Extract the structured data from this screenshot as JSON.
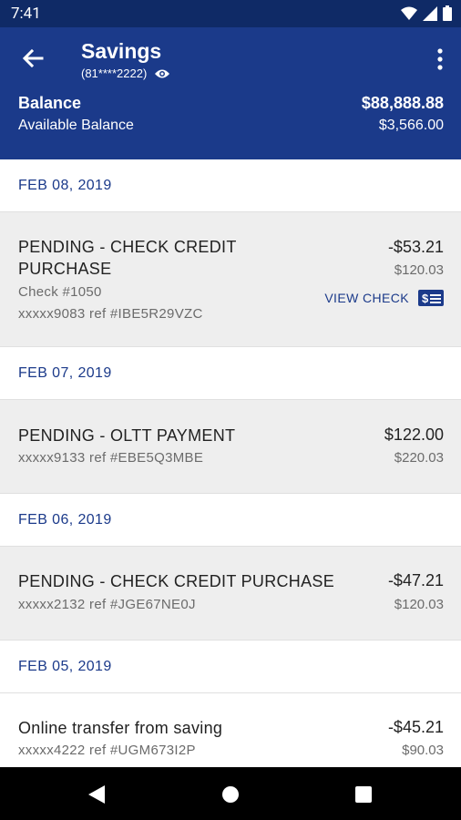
{
  "status": {
    "time": "7:41"
  },
  "header": {
    "title": "Savings",
    "account_number": "(81****2222)",
    "balance_label": "Balance",
    "balance_value": "$88,888.88",
    "available_label": "Available Balance",
    "available_value": "$3,566.00"
  },
  "groups": [
    {
      "date": "FEB 08, 2019",
      "transactions": [
        {
          "description_line1": "PENDING - CHECK CREDIT",
          "description_line2": "PURCHASE",
          "check": "Check #1050",
          "ref": "xxxxx9083 ref #IBE5R29VZC",
          "amount": "-$53.21",
          "balance": "$120.03",
          "view_check_label": "VIEW CHECK"
        }
      ]
    },
    {
      "date": "FEB 07, 2019",
      "transactions": [
        {
          "description": "PENDING - OLTT PAYMENT",
          "ref": "xxxxx9133 ref #EBE5Q3MBE",
          "amount": "$122.00",
          "balance": "$220.03"
        }
      ]
    },
    {
      "date": "FEB 06, 2019",
      "transactions": [
        {
          "description": "PENDING - CHECK CREDIT PURCHASE",
          "ref": "xxxxx2132 ref #JGE67NE0J",
          "amount": "-$47.21",
          "balance": "$120.03"
        }
      ]
    },
    {
      "date": "FEB 05, 2019",
      "transactions": [
        {
          "description": "Online transfer from saving",
          "ref": "xxxxx4222 ref #UGM673I2P",
          "amount": "-$45.21",
          "balance": "$90.03"
        }
      ]
    }
  ],
  "colors": {
    "header": "#1b3a8a",
    "statusbar": "#0f2a66",
    "accent": "#1b3a8a",
    "row_bg": "#eeeeee"
  },
  "icons": [
    "wifi-icon",
    "signal-icon",
    "battery-icon",
    "back-arrow-icon",
    "eye-icon",
    "more-vert-icon",
    "check-icon",
    "nav-back-icon",
    "nav-home-icon",
    "nav-recents-icon"
  ]
}
